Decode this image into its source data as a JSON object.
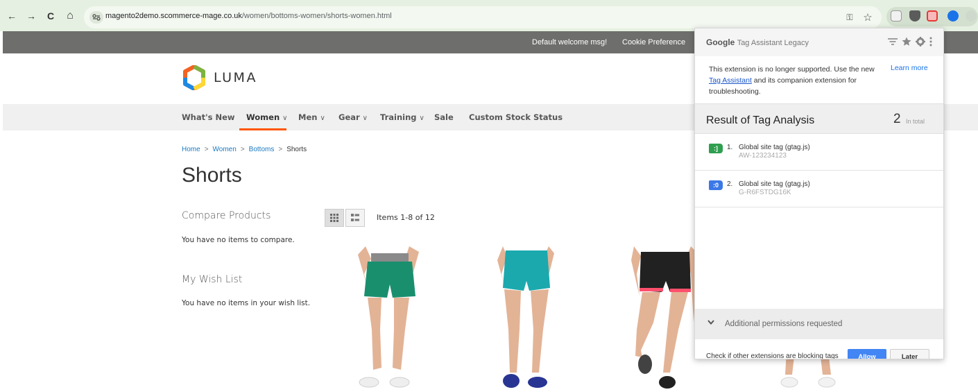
{
  "browser": {
    "back_icon": "←",
    "forward_icon": "→",
    "reload_icon": "C",
    "home_icon": "⌂",
    "url_host": "magento2demo.scommerce-mage.co.uk",
    "url_path": "/women/bottoms-women/shorts-women.html",
    "password_icon": "⚿",
    "bookmark_icon": "☆"
  },
  "panel_header": {
    "welcome": "Default welcome msg!",
    "cookie": "Cookie Preference"
  },
  "logo": {
    "text": "LUMA"
  },
  "nav": {
    "whats_new": "What's New",
    "women": "Women",
    "men": "Men",
    "gear": "Gear",
    "training": "Training",
    "sale": "Sale",
    "custom_stock": "Custom Stock Status",
    "chevron": "∨"
  },
  "breadcrumb": {
    "home": "Home",
    "women": "Women",
    "bottoms": "Bottoms",
    "current": "Shorts",
    "sep": ">"
  },
  "page": {
    "title": "Shorts",
    "items_amount": "Items 1-8 of 12"
  },
  "sidebar": {
    "compare_heading": "Compare Products",
    "compare_empty": "You have no items to compare.",
    "wishlist_heading": "My Wish List",
    "wishlist_empty": "You have no items in your wish list."
  },
  "tag_assistant": {
    "brand": "Google",
    "product": "Tag Assistant Legacy",
    "msg_before": "This extension is no longer supported. Use the new ",
    "msg_link": "Tag Assistant",
    "msg_after": " and its companion extension for troubleshooting.",
    "learn_more": "Learn more",
    "result_title": "Result of Tag Analysis",
    "result_count": "2",
    "result_count_label": "In total",
    "tags": [
      {
        "num": "1.",
        "name": "Global site tag (gtag.js)",
        "id": "AW-123234123",
        "badge": ":]",
        "color": "#2e9e4f"
      },
      {
        "num": "2.",
        "name": "Global site tag (gtag.js)",
        "id": "G-R6FSTDG16K",
        "badge": ":0",
        "color": "#3b78e7"
      }
    ],
    "permissions": "Additional permissions requested",
    "check_text": "Check if other extensions are blocking tags",
    "allow": "Allow",
    "later": "Later"
  },
  "colors": {
    "chrome_bg": "#e6f0e2",
    "header_bar": "#6e6e6c",
    "link_blue": "#1979c3",
    "active_orange": "#ff5501",
    "allow_blue": "#4285f4"
  }
}
